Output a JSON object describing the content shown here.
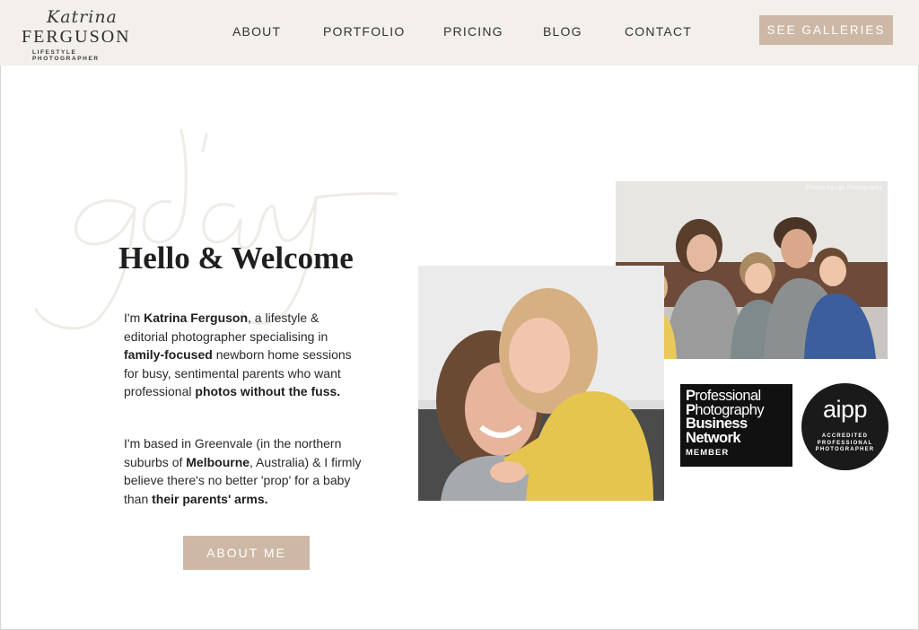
{
  "brand": {
    "script_name": "Katrina",
    "surname": "FERGUSON",
    "tagline": "LIFESTYLE PHOTOGRAPHER"
  },
  "nav": {
    "items": [
      {
        "label": "ABOUT"
      },
      {
        "label": "PORTFOLIO"
      },
      {
        "label": "PRICING"
      },
      {
        "label": "BLOG"
      },
      {
        "label": "CONTACT"
      }
    ],
    "cta_label": "SEE GALLERIES"
  },
  "hero": {
    "bg_script_word": "g'day",
    "title": "Hello & Welcome",
    "para1": {
      "t1": "I'm ",
      "b1": "Katrina Ferguson",
      "t2": ", a lifestyle & editorial photographer specialising in ",
      "b2": "family-focused",
      "t3": " newborn home sessions for busy, sentimental parents who want professional ",
      "b3": "photos without the fuss."
    },
    "para2": {
      "t1": "I'm based in Greenvale (in the northern suburbs of ",
      "b1": "Melbourne",
      "t2": ", Australia) & I firmly believe there's no better 'prop' for a baby than ",
      "b2": "their parents' arms."
    },
    "cta_label": "ABOUT ME"
  },
  "photos": {
    "credit": "Photos by Lyli Photography"
  },
  "badges": {
    "ppbn": {
      "line1_initial": "P",
      "line1_rest": "rofessional",
      "line2_initial": "P",
      "line2_rest": "hotography",
      "line3_initial": "B",
      "line3_rest": "usiness",
      "line4_initial": "N",
      "line4_rest": "etwork",
      "member": "MEMBER"
    },
    "aipp": {
      "logo": "aipp",
      "line1": "ACCREDITED",
      "line2": "PROFESSIONAL",
      "line3": "PHOTOGRAPHER"
    }
  },
  "colors": {
    "header_bg": "#f3efea",
    "accent": "#cdb8a6"
  }
}
